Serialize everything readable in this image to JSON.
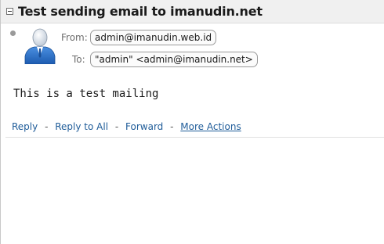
{
  "message": {
    "subject": "Test sending email to imanudin.net",
    "from_label": "From:",
    "from_value": "admin@imanudin.web.id",
    "to_label": "To:",
    "to_value": "\"admin\" <admin@imanudin.net>",
    "body": "This is a test mailing"
  },
  "actions": {
    "reply": "Reply",
    "reply_all": "Reply to All",
    "forward": "Forward",
    "more": "More Actions",
    "separator": "-"
  },
  "colors": {
    "link": "#1f5c99",
    "header_bg": "#f0f0f0",
    "avatar_blue": "#2a6fc9"
  },
  "icons": {
    "collapse": "collapse-minus-icon",
    "avatar": "person-avatar-icon",
    "bullet": "unread-dot-icon"
  }
}
